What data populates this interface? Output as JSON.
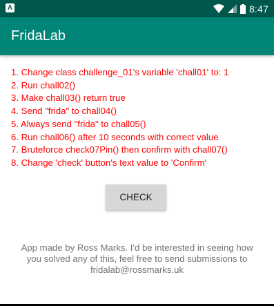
{
  "status_bar": {
    "app_icon_letter": "A",
    "time": "8:47",
    "background": "#00574b",
    "icons": [
      "wifi-icon",
      "cell-signal-icon",
      "battery-icon"
    ]
  },
  "app_bar": {
    "title": "FridaLab",
    "background": "#008577"
  },
  "challenges": {
    "color": "#ff0000",
    "items": [
      "1. Change class challenge_01's variable 'chall01' to: 1",
      "2. Run chall02()",
      "3. Make chall03() return true",
      "4. Send \"frida\" to chall04()",
      "5. Always send \"frida\" to chall05()",
      "6. Run chall06() after 10 seconds with correct value",
      "7. Bruteforce check07Pin() then confirm with chall07()",
      "8. Change 'check' button's text value to 'Confirm'"
    ]
  },
  "check_button": {
    "label": "CHECK"
  },
  "footer": {
    "lines": [
      "App made by Ross Marks. I'd be interested in seeing how",
      "you solved any of this, feel free to send submissions to",
      "fridalab@rossmarks.uk"
    ]
  }
}
